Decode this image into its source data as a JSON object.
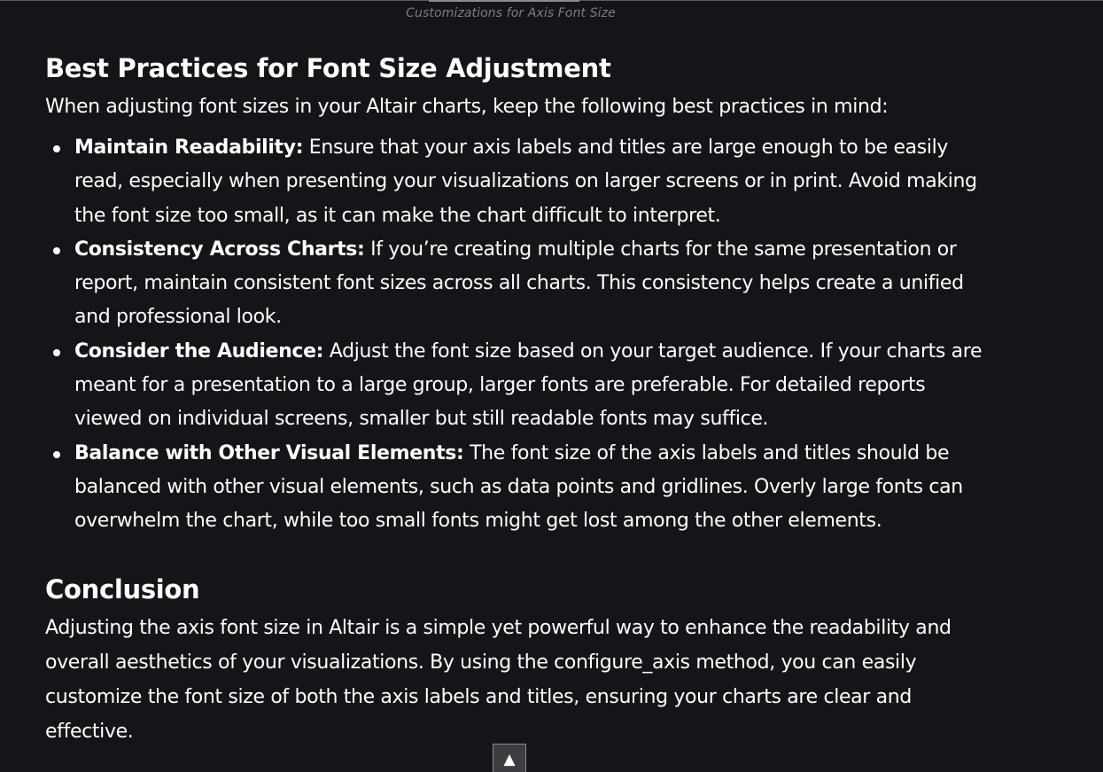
{
  "figure": {
    "caption": "Customizations for Axis Font Size"
  },
  "best_practices": {
    "heading": "Best Practices for Font Size Adjustment",
    "intro": "When adjusting font sizes in your Altair charts, keep the following best practices in mind:",
    "items": [
      {
        "term": "Maintain Readability:",
        "text": " Ensure that your axis labels and titles are large enough to be easily read, especially when presenting your visualizations on larger screens or in print. Avoid making the font size too small, as it can make the chart difficult to interpret."
      },
      {
        "term": "Consistency Across Charts:",
        "text": " If you’re creating multiple charts for the same presentation or report, maintain consistent font sizes across all charts. This consistency helps create a unified and professional look."
      },
      {
        "term": "Consider the Audience:",
        "text": " Adjust the font size based on your target audience. If your charts are meant for a presentation to a large group, larger fonts are preferable. For detailed reports viewed on individual screens, smaller but still readable fonts may suffice."
      },
      {
        "term": "Balance with Other Visual Elements:",
        "text": " The font size of the axis labels and titles should be balanced with other visual elements, such as data points and gridlines. Overly large fonts can overwhelm the chart, while too small fonts might get lost among the other elements."
      }
    ]
  },
  "conclusion": {
    "heading": "Conclusion",
    "text": "Adjusting the axis font size in Altair is a simple yet powerful way to enhance the readability and overall aesthetics of your visualizations. By using the configure_axis method, you can easily customize the font size of both the axis labels and titles, ensuring your charts are clear and effective."
  },
  "controls": {
    "back_to_top": "▲",
    "back_to_top_icon": "triangle-up-icon"
  },
  "colors": {
    "background": "#141518",
    "text": "#ffffff",
    "caption": "#7b7d82",
    "button_bg": "#3c3d40"
  }
}
